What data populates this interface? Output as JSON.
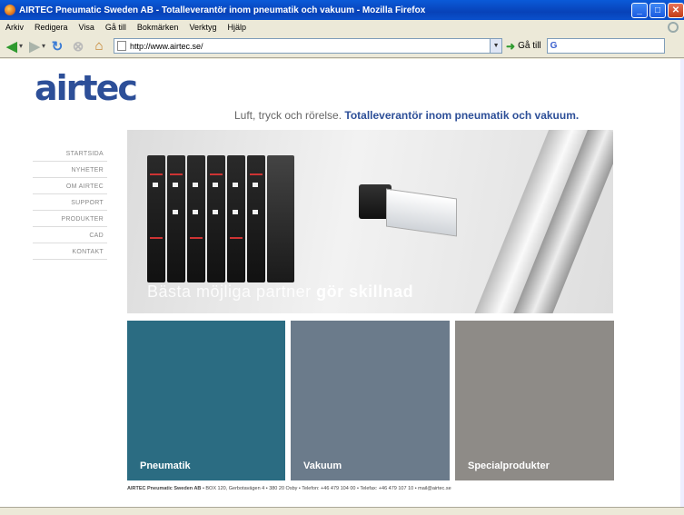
{
  "window": {
    "title": "AIRTEC Pneumatic Sweden AB - Totalleverantör inom pneumatik och vakuum - Mozilla Firefox"
  },
  "menu": [
    "Arkiv",
    "Redigera",
    "Visa",
    "Gå till",
    "Bokmärken",
    "Verktyg",
    "Hjälp"
  ],
  "toolbar": {
    "url": "http://www.airtec.se/",
    "go_label": "Gå till",
    "search_label": "G"
  },
  "page": {
    "logo": "airtec",
    "tagline_light": "Luft, tryck och rörelse.",
    "tagline_strong": "Totalleverantör inom pneumatik och vakuum.",
    "nav": [
      "STARTSIDA",
      "NYHETER",
      "OM AIRTEC",
      "SUPPORT",
      "PRODUKTER",
      "CAD",
      "KONTAKT"
    ],
    "hero_light": "Bästa möjliga partner",
    "hero_strong": "gör skillnad",
    "tiles": [
      "Pneumatik",
      "Vakuum",
      "Specialprodukter"
    ],
    "footer_strong": "AIRTEC Pneumatic Sweden AB",
    "footer_rest": "• BOX 120, Gerbotavägen 4 • 380 20 Osby • Telefon: +46 479 104 00 • Telefax: +46 479 107 10 • mail@airtec.se"
  },
  "colors": {
    "brand": "#2d4f98",
    "tile_pneumatik": "#2b6c82",
    "tile_vakuum": "#6b7b8b",
    "tile_special": "#8e8b87"
  }
}
